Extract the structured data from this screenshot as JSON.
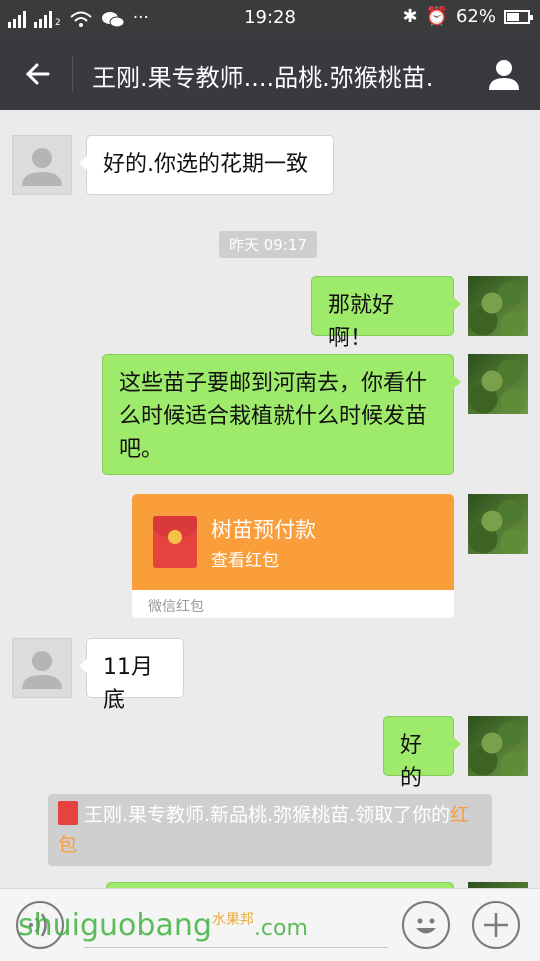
{
  "status_bar": {
    "time": "19:28",
    "battery": "62%",
    "battery_level": 0.62
  },
  "header": {
    "title": "王刚.果专教师....品桃.弥猴桃苗."
  },
  "messages": {
    "m1": "好的.你选的花期一致",
    "time_chip": "昨天 09:17",
    "m2": "那就好啊！",
    "m3": "这些苗子要邮到河南去，你看什么时候适合栽植就什么时候发苗吧。",
    "red_packet": {
      "title": "树苗预付款",
      "subtitle": "查看红包",
      "footer": "微信红包"
    },
    "m4": "11月底",
    "m5": "好的",
    "system_note": {
      "text": "王刚.果专教师.新品桃.弥猴桃苗.领取了你的",
      "highlight": "红包"
    }
  },
  "watermark": {
    "text": "shuiguobang",
    "suffix": ".com",
    "cn": "水果邦"
  }
}
